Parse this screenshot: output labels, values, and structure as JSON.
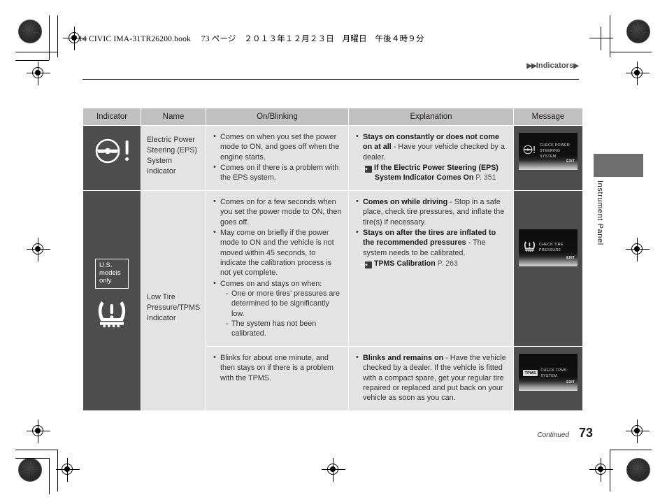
{
  "print_slug": "14 CIVIC IMA-31TR26200.book 　73 ページ　２０１３年１２月２３日　月曜日　午後４時９分",
  "header": {
    "breadcrumb_prefix": "▶▶",
    "breadcrumb_label": "Indicators",
    "breadcrumb_suffix": "▶"
  },
  "side_tab": {
    "label": "Instrument Panel"
  },
  "table": {
    "columns": [
      "Indicator",
      "Name",
      "On/Blinking",
      "Explanation",
      "Message"
    ],
    "rows": [
      {
        "indicator_icon": "eps-steering-wheel-warning-icon",
        "name": "Electric Power Steering (EPS) System Indicator",
        "on_blinking": [
          "Comes on when you set the power mode to ON, and goes off when the engine starts.",
          "Comes on if there is a problem with the EPS system."
        ],
        "explanation": [
          {
            "bold": "Stays on constantly or does not come on at all",
            "rest": " - Have your vehicle checked by a dealer."
          }
        ],
        "xref": {
          "icon": "reference-arrow-icon",
          "title": "If the Electric Power Steering (EPS) System Indicator Comes On",
          "page": "P. 351"
        },
        "message": {
          "icon": "eps-steering-wheel-warning-icon",
          "lines": [
            "CHECK POWER",
            "STEERING SYSTEM"
          ],
          "exit_label": "EXIT"
        }
      },
      {
        "indicator_icon": "tpms-low-tire-pressure-icon",
        "indicator_note": "U.S. models only",
        "name": "Low Tire Pressure/TPMS Indicator",
        "on_blinking": [
          "Comes on for a few seconds when you set the power mode to ON, then goes off.",
          "May come on briefly if the power mode to ON and the vehicle is not moved within 45 seconds, to indicate the calibration process is not yet complete."
        ],
        "on_blinking_last_lead": "Comes on and stays on when:",
        "on_blinking_sub": [
          "One or more tires’ pressures are determined to be significantly low.",
          "The system has not been calibrated."
        ],
        "explanation": [
          {
            "bold": "Comes on while driving",
            "rest": " - Stop in a safe place, check tire pressures, and inflate the tire(s) if necessary."
          },
          {
            "bold": "Stays on after the tires are inflated to the recommended pressures",
            "rest": " - The system needs to be calibrated."
          }
        ],
        "xref": {
          "icon": "reference-arrow-icon",
          "title": "TPMS Calibration",
          "page": "P. 263"
        },
        "message": {
          "icon": "tpms-low-tire-pressure-icon",
          "lines": [
            "CHECK TIRE",
            "PRESSURE"
          ],
          "exit_label": "EXIT"
        }
      },
      {
        "on_blinking": [
          "Blinks for about one minute, and then stays on if there is a problem with the TPMS."
        ],
        "explanation": [
          {
            "bold": "Blinks and remains on",
            "rest": " - Have the vehicle checked by a dealer. If the vehicle is fitted with a compact spare, get your regular tire repaired or replaced and put back on your vehicle as soon as you can."
          }
        ],
        "message": {
          "badge": "TPMS",
          "lines": [
            "CHECK TPMS SYSTEM"
          ],
          "exit_label": "EXIT"
        }
      }
    ]
  },
  "footer": {
    "continued": "Continued",
    "page_number": "73"
  }
}
